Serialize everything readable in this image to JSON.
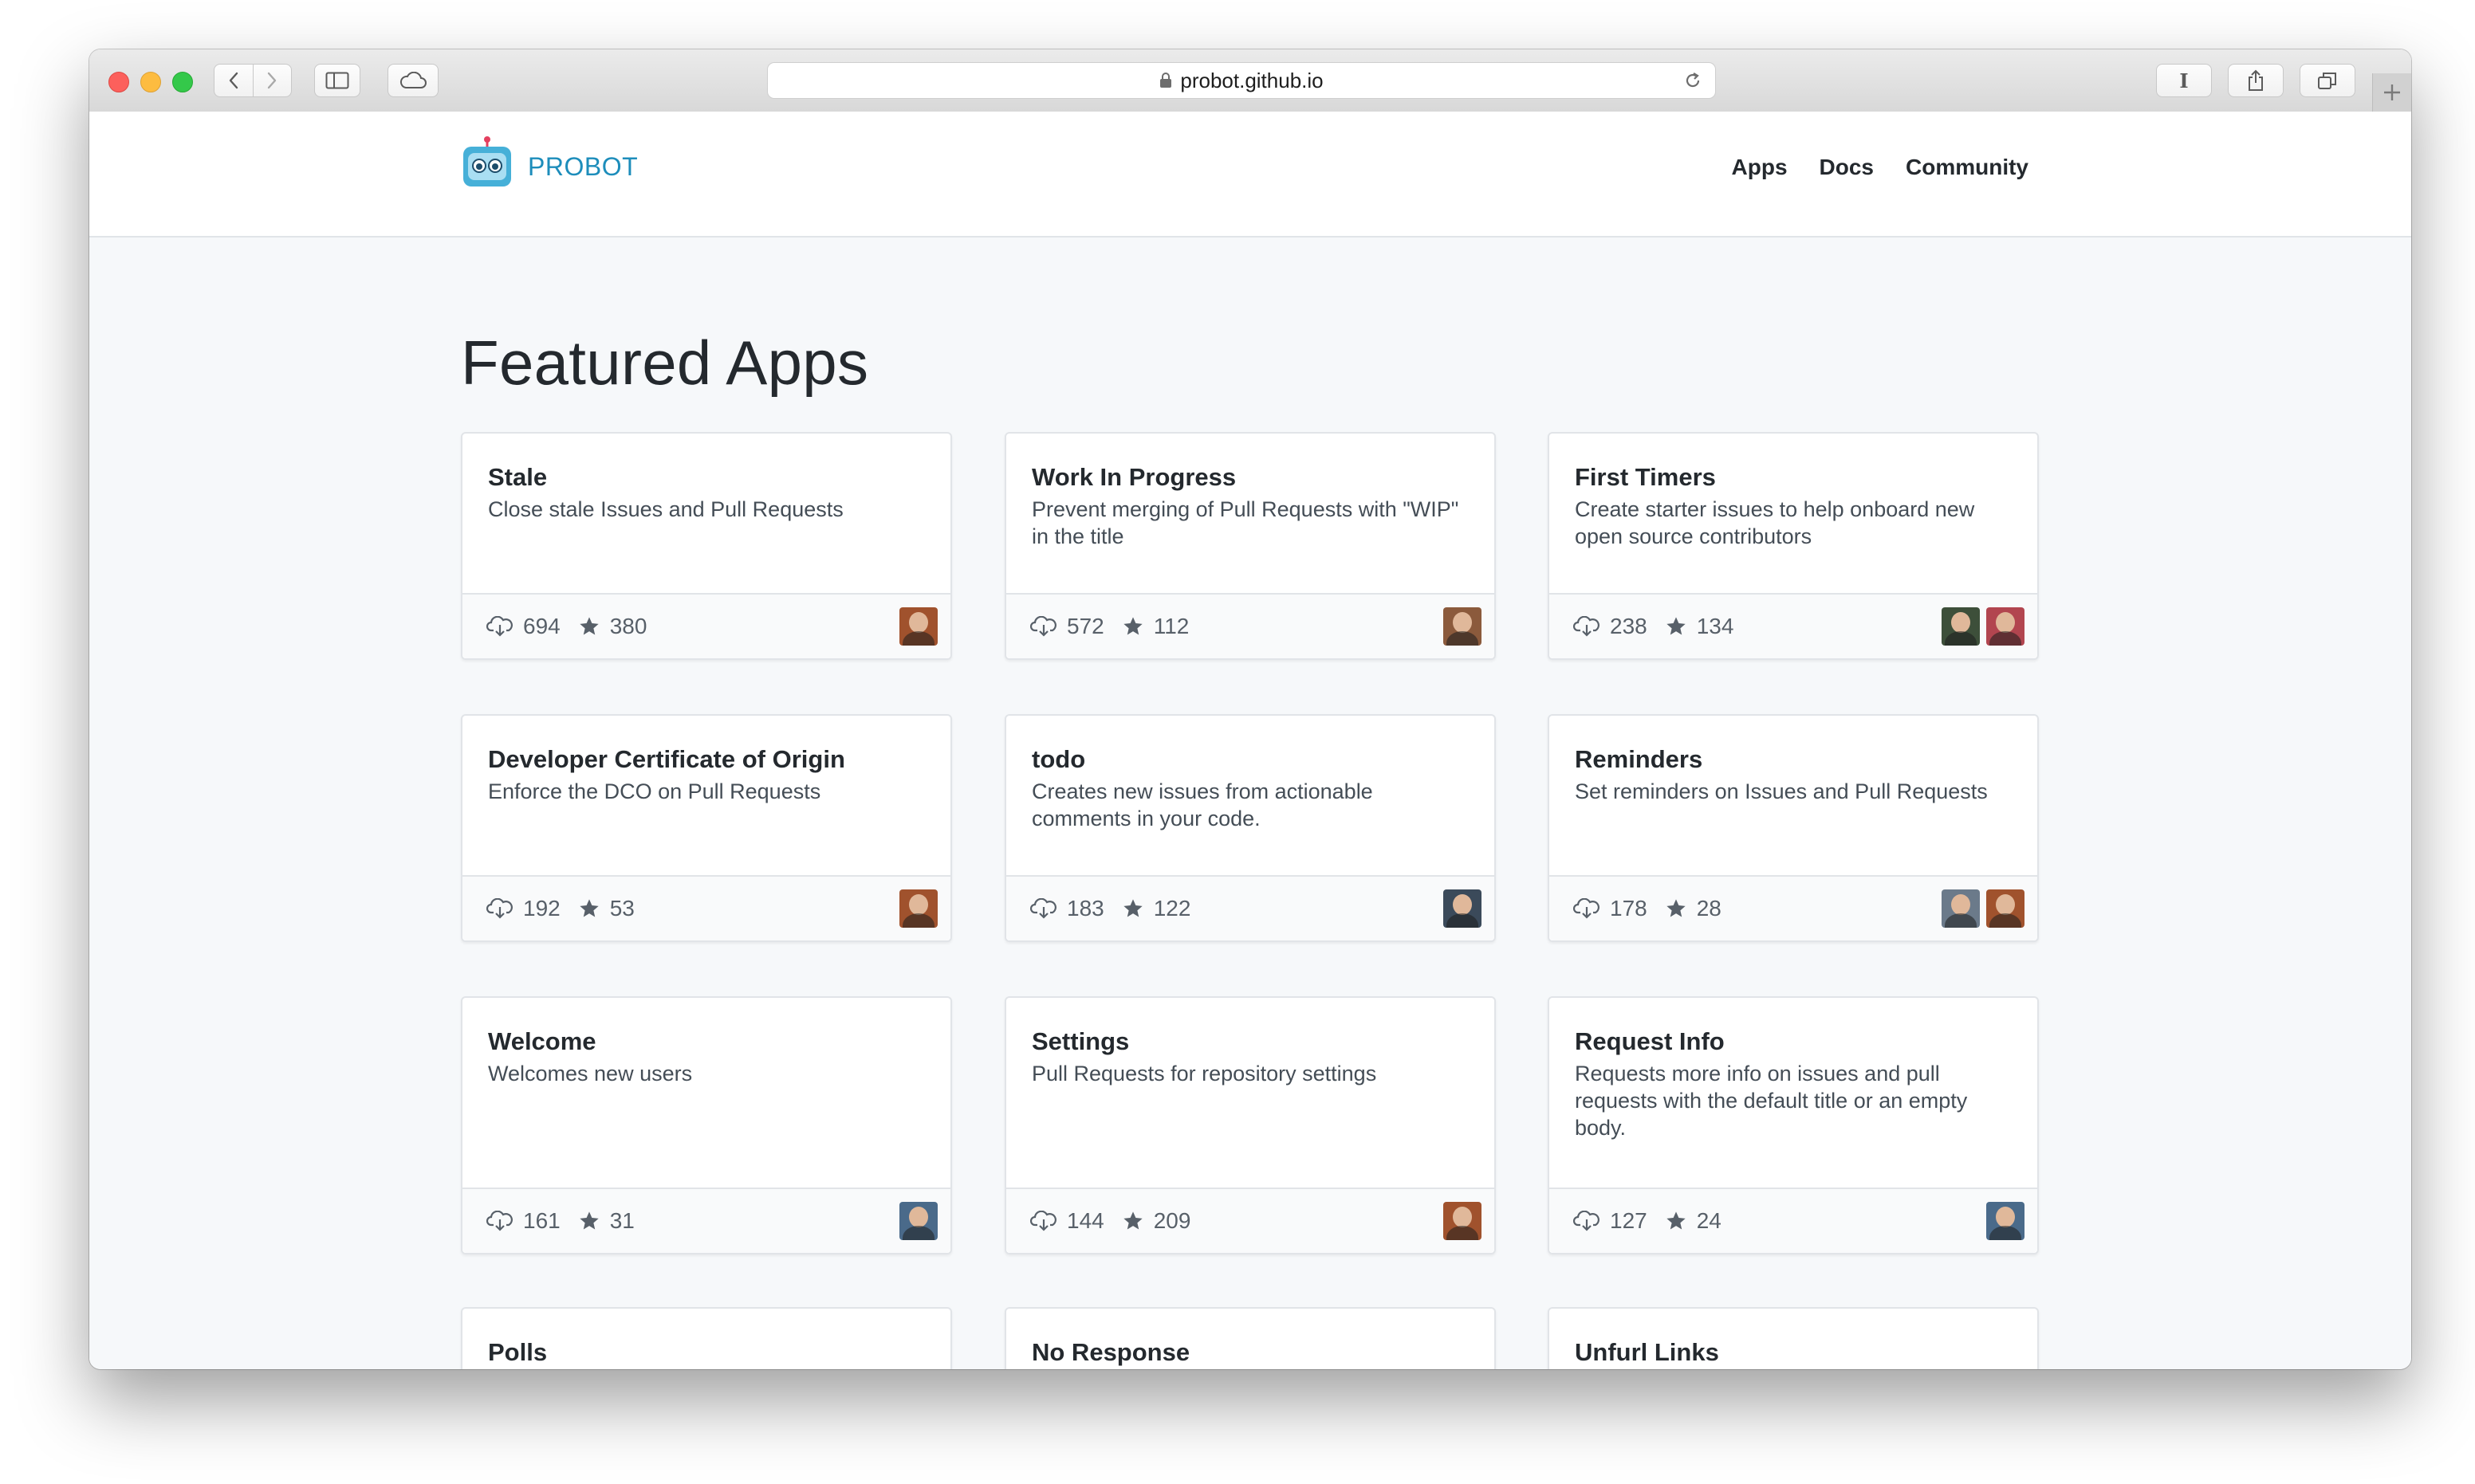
{
  "browser": {
    "url": "probot.github.io",
    "reader_label": "I"
  },
  "site": {
    "brand": "PROBOT",
    "nav": [
      {
        "label": "Apps"
      },
      {
        "label": "Docs"
      },
      {
        "label": "Community"
      }
    ]
  },
  "section_title": "Featured Apps",
  "apps": [
    {
      "title": "Stale",
      "description": "Close stale Issues and Pull Requests",
      "installs": "694",
      "stars": "380",
      "avatars": [
        "#a0522d"
      ]
    },
    {
      "title": "Work In Progress",
      "description": "Prevent merging of Pull Requests with \"WIP\" in the title",
      "installs": "572",
      "stars": "112",
      "avatars": [
        "#8b5a3c"
      ]
    },
    {
      "title": "First Timers",
      "description": "Create starter issues to help onboard new open source contributors",
      "installs": "238",
      "stars": "134",
      "avatars": [
        "#3d4f3a",
        "#b2454f"
      ]
    },
    {
      "title": "Developer Certificate of Origin",
      "description": "Enforce the DCO on Pull Requests",
      "installs": "192",
      "stars": "53",
      "avatars": [
        "#a0522d"
      ]
    },
    {
      "title": "todo",
      "description": "Creates new issues from actionable comments in your code.",
      "installs": "183",
      "stars": "122",
      "avatars": [
        "#3b4a5a"
      ]
    },
    {
      "title": "Reminders",
      "description": "Set reminders on Issues and Pull Requests",
      "installs": "178",
      "stars": "28",
      "avatars": [
        "#6b7a8a",
        "#a0522d"
      ]
    },
    {
      "title": "Welcome",
      "description": "Welcomes new users",
      "installs": "161",
      "stars": "31",
      "avatars": [
        "#4a6a8a"
      ]
    },
    {
      "title": "Settings",
      "description": "Pull Requests for repository settings",
      "installs": "144",
      "stars": "209",
      "avatars": [
        "#a0522d"
      ]
    },
    {
      "title": "Request Info",
      "description": "Requests more info on issues and pull requests with the default title or an empty body.",
      "installs": "127",
      "stars": "24",
      "avatars": [
        "#4a6a8a"
      ]
    },
    {
      "title": "Polls",
      "description": "",
      "installs": "",
      "stars": "",
      "avatars": []
    },
    {
      "title": "No Response",
      "description": "",
      "installs": "",
      "stars": "",
      "avatars": []
    },
    {
      "title": "Unfurl Links",
      "description": "",
      "installs": "",
      "stars": "",
      "avatars": []
    }
  ],
  "colors": {
    "brand": "#1d8dbb",
    "page_background": "#f6f8fa",
    "text_primary": "#24292e",
    "text_secondary": "#586069"
  },
  "icons": {
    "install": "cloud-download-icon",
    "stars": "star-icon"
  }
}
